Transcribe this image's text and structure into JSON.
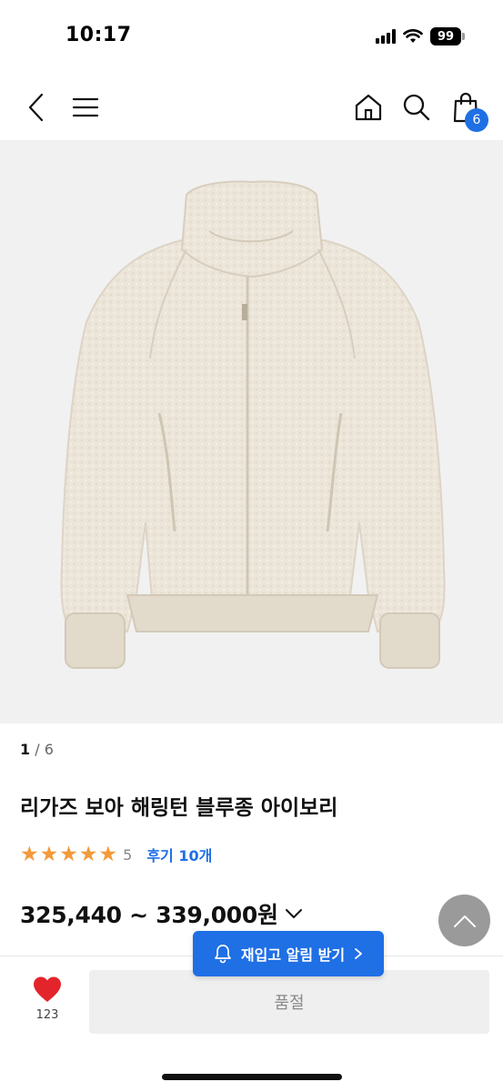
{
  "status_bar": {
    "time": "10:17",
    "battery": "99"
  },
  "nav": {
    "cart_count": "6"
  },
  "pager": {
    "current": "1",
    "separator": " / ",
    "total": "6"
  },
  "product": {
    "title": "리가즈 보아 해링턴 블루종 아이보리",
    "rating_stars": 5,
    "rating_score": "5",
    "review_link": "후기 10개",
    "price_range": "325,440 ~ 339,000원"
  },
  "actions": {
    "restock_label": "재입고 알림 받기",
    "soldout_label": "품절",
    "like_count": "123"
  },
  "colors": {
    "accent": "#1f6fe5",
    "star": "#f39a3a",
    "like": "#e3242b"
  }
}
